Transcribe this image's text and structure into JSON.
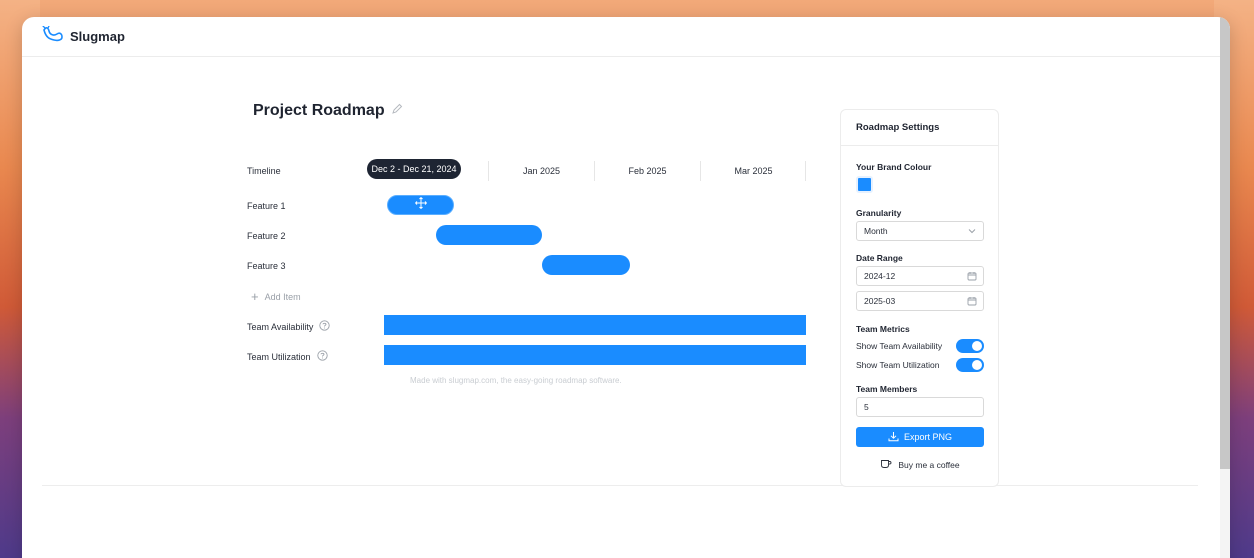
{
  "app": {
    "name": "Slugmap"
  },
  "roadmap": {
    "title": "Project Roadmap",
    "timeline_label": "Timeline",
    "selection_tooltip": "Dec 2 - Dec 21, 2024",
    "months": [
      "Jan 2025",
      "Feb 2025",
      "Mar 2025"
    ],
    "features": [
      {
        "label": "Feature 1"
      },
      {
        "label": "Feature 2"
      },
      {
        "label": "Feature 3"
      }
    ],
    "add_item": "Add Item",
    "team_rows": [
      {
        "label": "Team Availability"
      },
      {
        "label": "Team Utilization"
      }
    ],
    "footer_note": "Made with slugmap.com, the easy-going roadmap software."
  },
  "settings": {
    "title": "Roadmap Settings",
    "brand_colour_label": "Your Brand Colour",
    "brand_colour": "#1a8cff",
    "granularity_label": "Granularity",
    "granularity_value": "Month",
    "date_range_label": "Date Range",
    "date_start": "2024-12",
    "date_end": "2025-03",
    "team_metrics_label": "Team Metrics",
    "show_availability_label": "Show Team Availability",
    "show_utilization_label": "Show Team Utilization",
    "show_availability": true,
    "show_utilization": true,
    "team_members_label": "Team Members",
    "team_members_value": "5",
    "export_label": "Export PNG",
    "coffee_label": "Buy me a coffee"
  },
  "icons": {
    "logo": "slug-logo-icon",
    "edit": "pencil-icon",
    "move": "move-icon",
    "help": "help-circle-icon",
    "calendar": "calendar-icon",
    "dropdown": "chevron-down-icon",
    "download": "download-icon",
    "coffee": "coffee-icon"
  }
}
